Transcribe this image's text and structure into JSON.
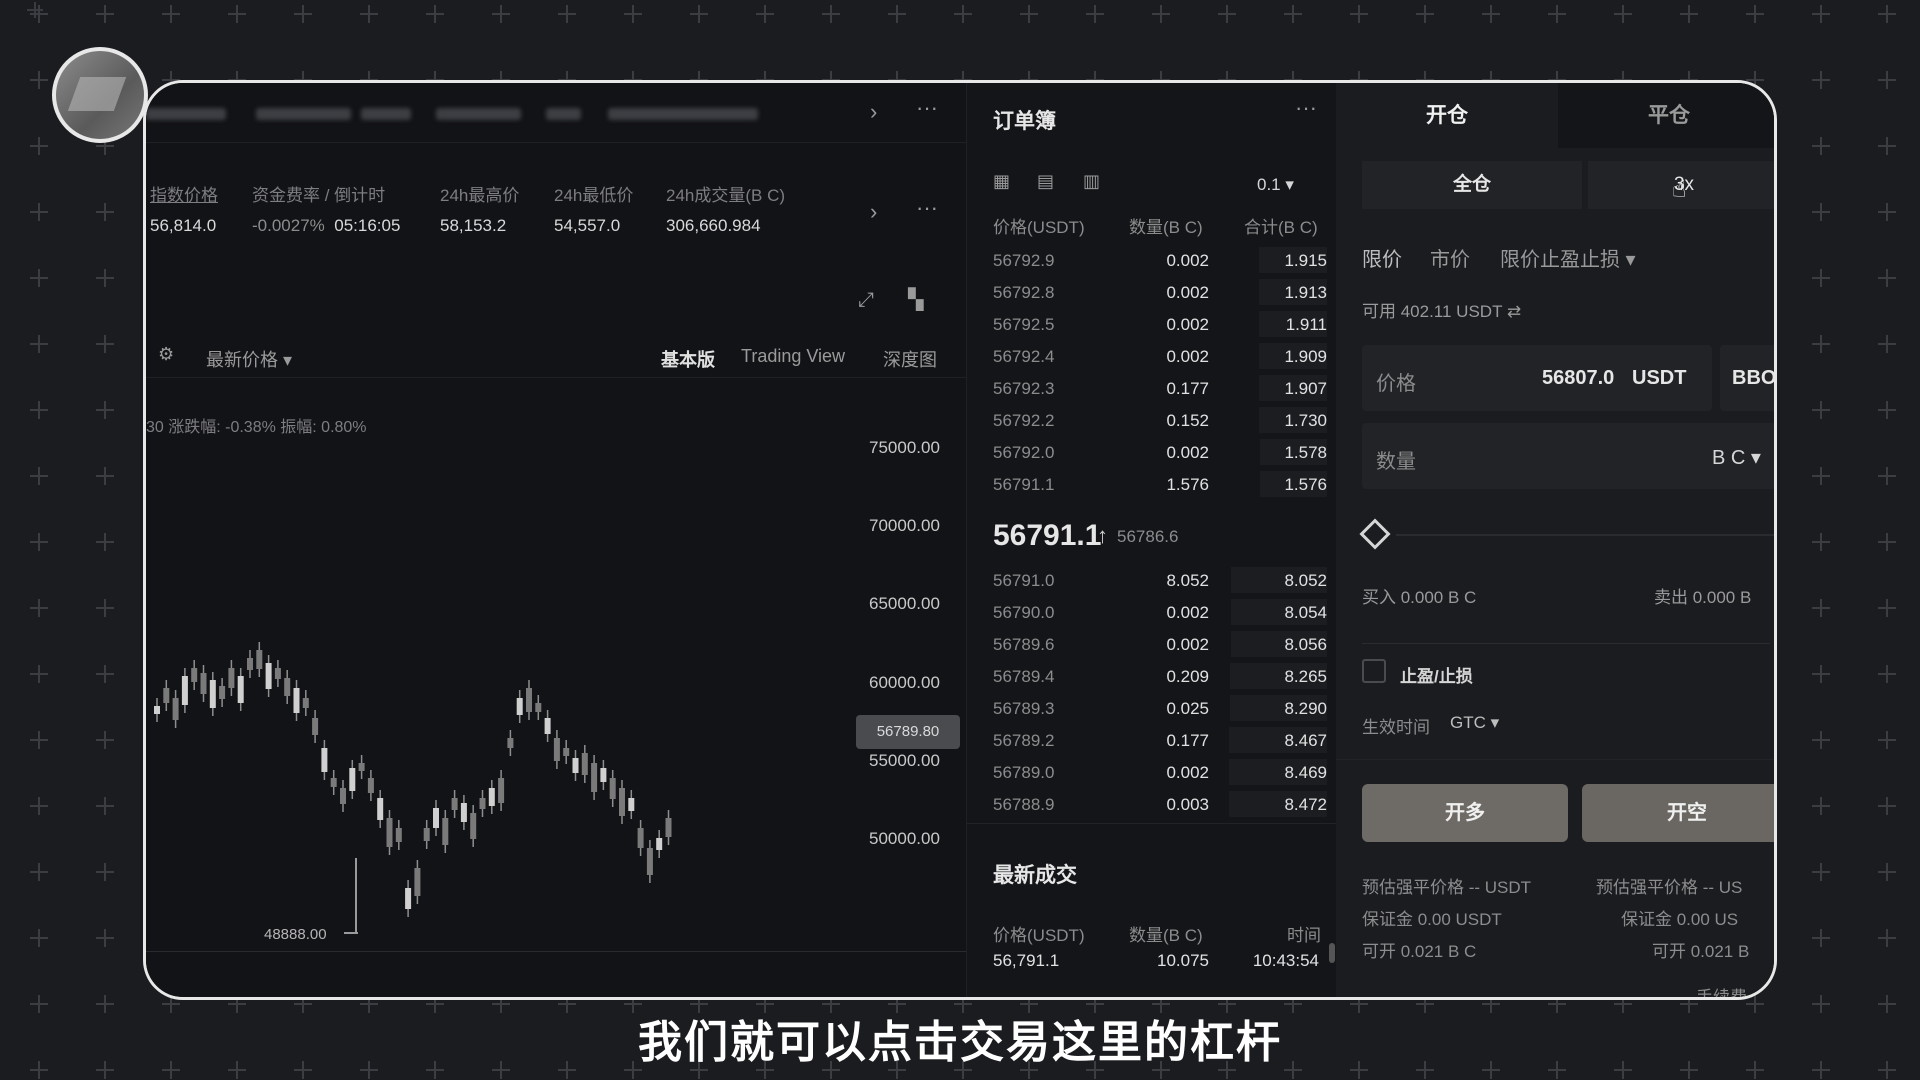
{
  "subtitle": "我们就可以点击交易这里的杠杆",
  "stats": [
    {
      "label": "指数价格",
      "value": "56,814.0"
    },
    {
      "label": "资金费率 / 倒计时",
      "value": "-0.0027%",
      "value2": "05:16:05"
    },
    {
      "label": "24h最高价",
      "value": "58,153.2"
    },
    {
      "label": "24h最低价",
      "value": "54,557.0"
    },
    {
      "label": "24h成交量(B C)",
      "value": "306,660.984"
    }
  ],
  "chart": {
    "settings_label": "最新价格 ▾",
    "views": [
      "基本版",
      "Trading View",
      "深度图"
    ],
    "change_text": "30 涨跌幅: -0.38% 振幅: 0.80%",
    "y_ticks": [
      "75000.00",
      "70000.00",
      "65000.00",
      "60000.00",
      "55000.00",
      "50000.00"
    ],
    "current_price_tag": "56789.80",
    "low_label": "48888.00"
  },
  "orderbook": {
    "title": "订单簿",
    "precision": "0.1 ▾",
    "columns": [
      "价格(USDT)",
      "数量(B C)",
      "合计(B C)"
    ],
    "asks": [
      {
        "price": "56792.9",
        "qty": "0.002",
        "total": "1.915"
      },
      {
        "price": "56792.8",
        "qty": "0.002",
        "total": "1.913"
      },
      {
        "price": "56792.5",
        "qty": "0.002",
        "total": "1.911"
      },
      {
        "price": "56792.4",
        "qty": "0.002",
        "total": "1.909"
      },
      {
        "price": "56792.3",
        "qty": "0.177",
        "total": "1.907"
      },
      {
        "price": "56792.2",
        "qty": "0.152",
        "total": "1.730"
      },
      {
        "price": "56792.0",
        "qty": "0.002",
        "total": "1.578"
      },
      {
        "price": "56791.1",
        "qty": "1.576",
        "total": "1.576"
      }
    ],
    "last_price": "56791.1",
    "last_arrow": "↑",
    "mark_price": "56786.6",
    "bids": [
      {
        "price": "56791.0",
        "qty": "8.052",
        "total": "8.052"
      },
      {
        "price": "56790.0",
        "qty": "0.002",
        "total": "8.054"
      },
      {
        "price": "56789.6",
        "qty": "0.002",
        "total": "8.056"
      },
      {
        "price": "56789.4",
        "qty": "0.209",
        "total": "8.265"
      },
      {
        "price": "56789.3",
        "qty": "0.025",
        "total": "8.290"
      },
      {
        "price": "56789.2",
        "qty": "0.177",
        "total": "8.467"
      },
      {
        "price": "56789.0",
        "qty": "0.002",
        "total": "8.469"
      },
      {
        "price": "56788.9",
        "qty": "0.003",
        "total": "8.472"
      }
    ],
    "trades_title": "最新成交",
    "trade_columns": [
      "价格(USDT)",
      "数量(B C)",
      "时间"
    ],
    "trades": [
      {
        "price": "56,791.1",
        "qty": "10.075",
        "time": "10:43:54"
      }
    ]
  },
  "form": {
    "tab_open": "开仓",
    "tab_close": "平仓",
    "margin_mode": "全仓",
    "leverage": "3x",
    "order_types": [
      "限价",
      "市价",
      "限价止盈止损 ▾"
    ],
    "available": "可用 402.11 USDT ⇄",
    "price_label": "价格",
    "price_value": "56807.0",
    "price_unit": "USDT",
    "price_side": "BBO",
    "qty_label": "数量",
    "qty_unit": "B C ▾",
    "buy_label": "买入 0.000 B C",
    "sell_label": "卖出 0.000 B",
    "tpsl_label": "止盈/止损",
    "tif_label": "生效时间",
    "tif_value": "GTC ▾",
    "long_button": "开多",
    "short_button": "开空",
    "long_info": [
      "预估强平价格 -- USDT",
      "保证金 0.00 USDT",
      "可开 0.021 B C"
    ],
    "short_info": [
      "预估强平价格 -- US",
      "保证金 0.00 US",
      "可开 0.021 B"
    ],
    "fee_label": "手续费"
  }
}
